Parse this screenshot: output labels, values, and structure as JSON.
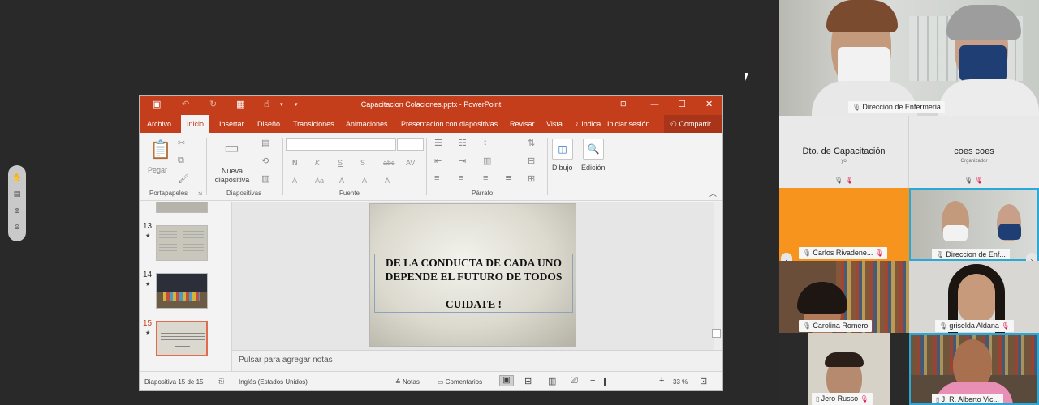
{
  "ppt": {
    "title": "Capacitacion Colaciones.pptx - PowerPoint",
    "tabs": [
      "Archivo",
      "Inicio",
      "Insertar",
      "Diseño",
      "Transiciones",
      "Animaciones",
      "Presentación con diapositivas",
      "Revisar",
      "Vista"
    ],
    "active_tab": "Inicio",
    "tell_me": "Indica",
    "sign_in": "Iniciar sesión",
    "share": "Compartir",
    "ribbon": {
      "paste": "Pegar",
      "new_slide": "Nueva diapositiva",
      "groups": [
        "Portapapeles",
        "Diapositivas",
        "Fuente",
        "Párrafo"
      ],
      "drawing": "Dibujo",
      "editing": "Edición"
    },
    "thumbnails": [
      {
        "num": "13",
        "star": "★"
      },
      {
        "num": "14",
        "star": "★"
      },
      {
        "num": "15",
        "star": "★",
        "active": true
      }
    ],
    "slide": {
      "line1": "DE LA CONDUCTA DE CADA UNO",
      "line2": "DEPENDE EL FUTURO DE TODOS",
      "line3": "CUIDATE !"
    },
    "notes_placeholder": "Pulsar para agregar notas",
    "status": {
      "slide_pos": "Diapositiva 15 de 15",
      "language": "Inglés (Estados Unidos)",
      "notes": "Notas",
      "comments": "Comentarios",
      "zoom": "33 %"
    }
  },
  "participants": {
    "top_video": "Direccion de Enfermeria",
    "capacitacion": {
      "name": "Dto. de Capacitación",
      "role": "yo"
    },
    "coes": {
      "name": "coes coes",
      "role": "Organizador"
    },
    "tiles": [
      {
        "name": "Carlos Rivadene..."
      },
      {
        "name": "Direccion de Enf..."
      },
      {
        "name": "Carolina Romero"
      },
      {
        "name": "griselda Aldana"
      },
      {
        "name": "Jero Russo"
      },
      {
        "name": "J. R. Alberto Vic..."
      }
    ]
  },
  "colors": {
    "ppt_accent": "#c43e1c",
    "orange_tile": "#f7941d",
    "active_speaker_border": "#2aa9d8"
  }
}
